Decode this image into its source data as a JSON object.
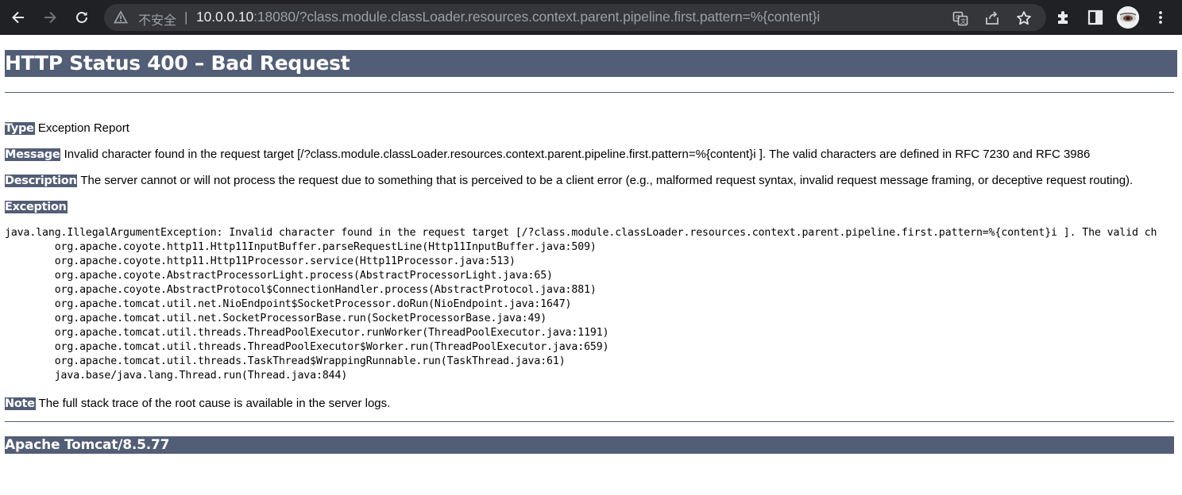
{
  "browser": {
    "security_label": "不安全",
    "separator": "|",
    "url_host": "10.0.0.10",
    "url_rest": ":18080/?class.module.classLoader.resources.context.parent.pipeline.first.pattern=%{content}i",
    "icons": [
      "back-arrow-icon",
      "forward-arrow-icon",
      "reload-icon",
      "warning-icon",
      "translate-icon",
      "share-icon",
      "star-icon",
      "extensions-icon",
      "side-panel-icon",
      "avatar",
      "menu-icon"
    ]
  },
  "error": {
    "title": "HTTP Status 400 – Bad Request",
    "type_label": "Type",
    "type_value": "Exception Report",
    "message_label": "Message",
    "message_value": "Invalid character found in the request target [/?class.module.classLoader.resources.context.parent.pipeline.first.pattern=%{content}i ]. The valid characters are defined in RFC 7230 and RFC 3986",
    "description_label": "Description",
    "description_value": "The server cannot or will not process the request due to something that is perceived to be a client error (e.g., malformed request syntax, invalid request message framing, or deceptive request routing).",
    "exception_label": "Exception",
    "stack_trace": "java.lang.IllegalArgumentException: Invalid character found in the request target [/?class.module.classLoader.resources.context.parent.pipeline.first.pattern=%{content}i ]. The valid ch\n\torg.apache.coyote.http11.Http11InputBuffer.parseRequestLine(Http11InputBuffer.java:509)\n\torg.apache.coyote.http11.Http11Processor.service(Http11Processor.java:513)\n\torg.apache.coyote.AbstractProcessorLight.process(AbstractProcessorLight.java:65)\n\torg.apache.coyote.AbstractProtocol$ConnectionHandler.process(AbstractProtocol.java:881)\n\torg.apache.tomcat.util.net.NioEndpoint$SocketProcessor.doRun(NioEndpoint.java:1647)\n\torg.apache.tomcat.util.net.SocketProcessorBase.run(SocketProcessorBase.java:49)\n\torg.apache.tomcat.util.threads.ThreadPoolExecutor.runWorker(ThreadPoolExecutor.java:1191)\n\torg.apache.tomcat.util.threads.ThreadPoolExecutor$Worker.run(ThreadPoolExecutor.java:659)\n\torg.apache.tomcat.util.threads.TaskThread$WrappingRunnable.run(TaskThread.java:61)\n\tjava.base/java.lang.Thread.run(Thread.java:844)",
    "note_label": "Note",
    "note_value": "The full stack trace of the root cause is available in the server logs.",
    "footer": "Apache Tomcat/8.5.77"
  },
  "colors": {
    "chrome_bg": "#202124",
    "omnibox_bg": "#35363a",
    "header_bg": "#525d76",
    "header_text": "#ffffff"
  }
}
